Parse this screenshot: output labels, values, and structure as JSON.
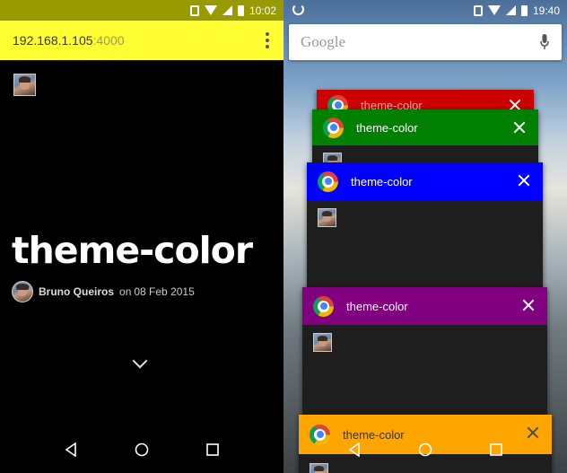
{
  "left_phone": {
    "status_time": "10:02",
    "theme_color": "#ffff33",
    "url": {
      "host": "192.168.1.105",
      "port": ":4000"
    },
    "post": {
      "title": "theme-color",
      "author": "Bruno Queiros",
      "date_prefix": "on",
      "date": "08 Feb 2015"
    }
  },
  "right_phone": {
    "status_time": "19:40",
    "search_brand": "Google",
    "tabs": [
      {
        "title": "theme-color",
        "color": "#cc0000"
      },
      {
        "title": "theme-color",
        "color": "#008000"
      },
      {
        "title": "theme-color",
        "color": "#0000ff"
      },
      {
        "title": "theme-color",
        "color": "#800080"
      },
      {
        "title": "theme-color",
        "color": "#ffa500"
      }
    ]
  }
}
